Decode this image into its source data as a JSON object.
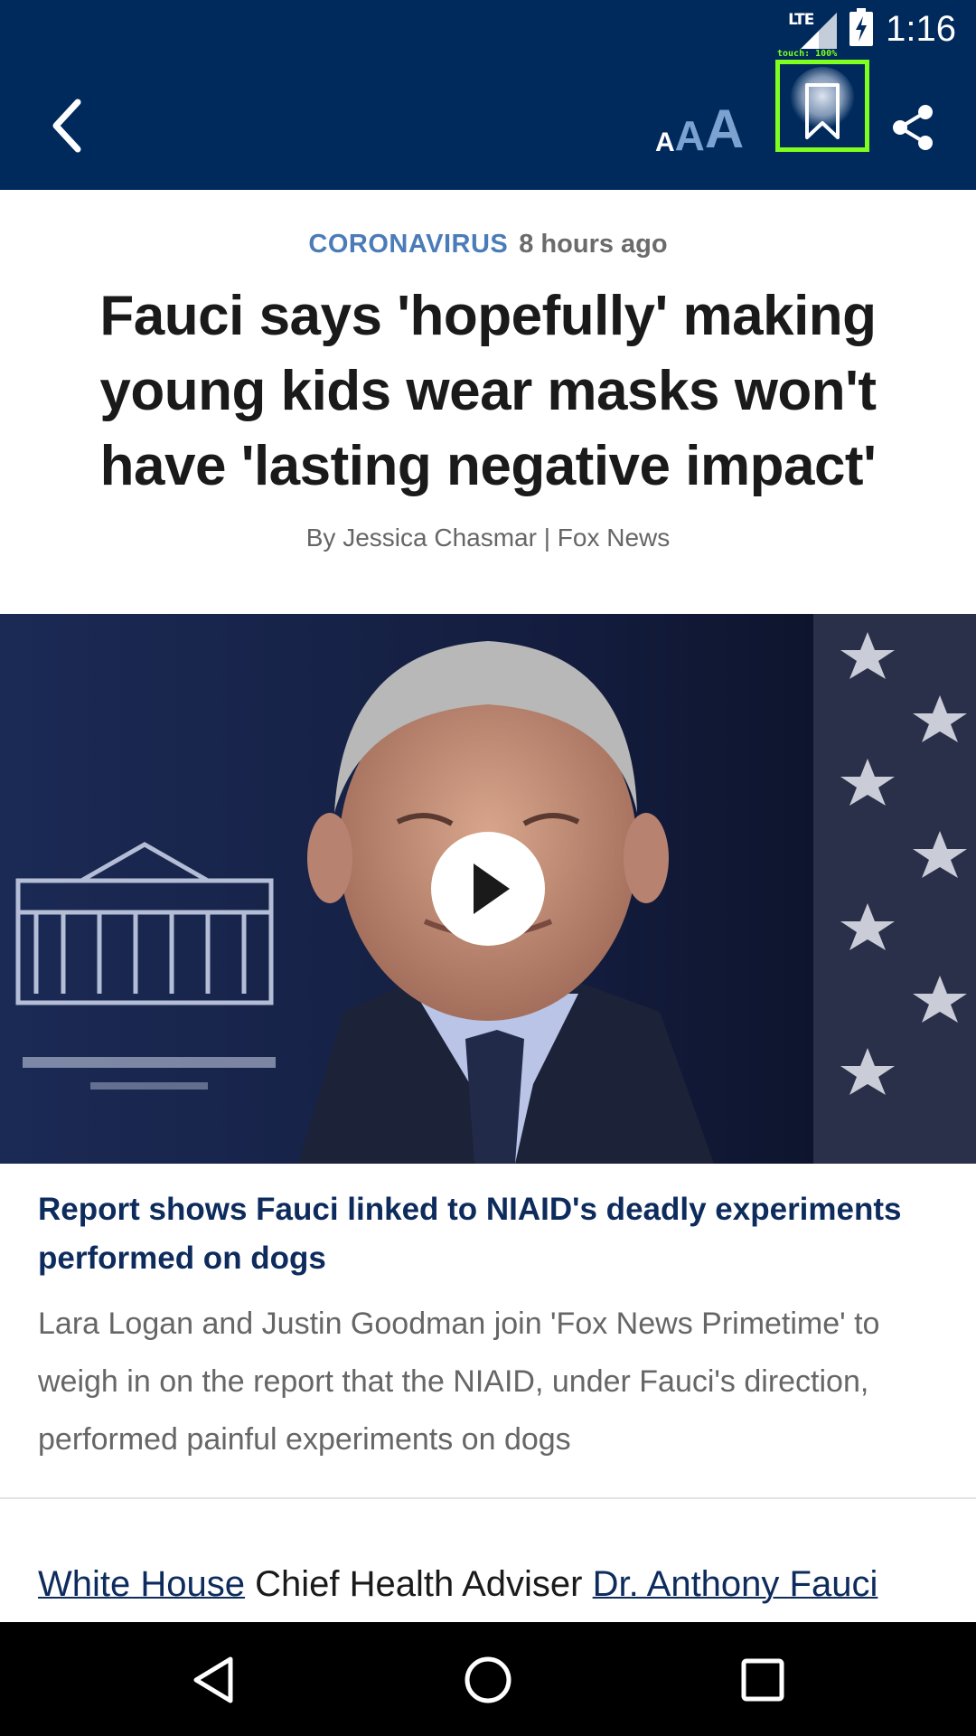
{
  "status_bar": {
    "network": "LTE",
    "time": "1:16"
  },
  "app_bar": {
    "back_icon": "chevron-left-icon",
    "font_size_icon": "text-size-icon",
    "font_size_glyphs": [
      "A",
      "A",
      "A"
    ],
    "bookmark_icon": "bookmark-icon",
    "share_icon": "share-icon",
    "touch_overlay": "touch: 100%"
  },
  "article": {
    "category": "CORONAVIRUS",
    "time_ago": "8 hours ago",
    "headline": "Fauci says 'hopefully' making young kids wear masks won't have 'lasting negative impact'",
    "byline": "By Jessica Chasmar | Fox News",
    "video": {
      "play_icon": "play-icon",
      "title": "Report shows Fauci linked to NIAID's deadly experiments performed on dogs",
      "description": "Lara Logan and Justin Goodman join 'Fox News Primetime' to weigh in on the report that the NIAID, under Fauci's direction, performed painful experiments on dogs"
    },
    "body_first_line": {
      "link1": "White House",
      "text1": " Chief Health Adviser ",
      "link2": "Dr. Anthony Fauci"
    }
  },
  "nav_bar": {
    "back_icon": "triangle-back-icon",
    "home_icon": "circle-home-icon",
    "recents_icon": "square-recents-icon"
  },
  "colors": {
    "app_bar": "#002a5c",
    "category": "#4b7cb8",
    "link": "#0d2b5c",
    "highlight": "#7fff1f"
  }
}
